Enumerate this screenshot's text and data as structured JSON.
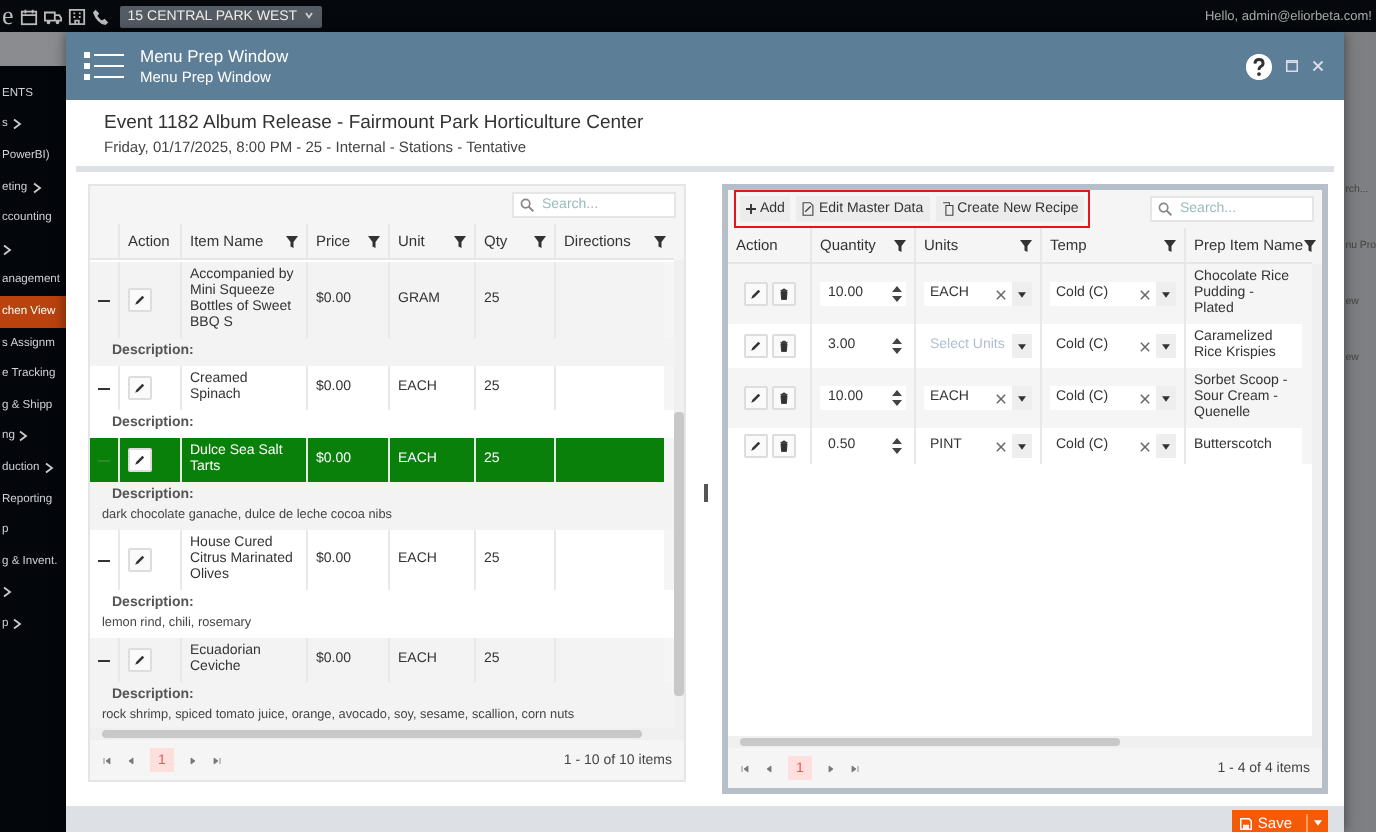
{
  "app": {
    "logo_fragment": "e",
    "location": "15 CENTRAL PARK WEST",
    "greeting": "Hello, admin@eliorbeta.com!",
    "sidebar": [
      {
        "label": "ENTS",
        "arrow": false,
        "selected": false
      },
      {
        "label": "s",
        "arrow": true,
        "selected": false
      },
      {
        "label": "PowerBI)",
        "arrow": false,
        "selected": false
      },
      {
        "label": "eting",
        "arrow": true,
        "selected": false
      },
      {
        "label": "ccounting",
        "arrow": false,
        "selected": false
      },
      {
        "arrow": true,
        "selected": false
      },
      {
        "label": "anagement",
        "arrow": false,
        "selected": false
      },
      {
        "label": "chen View",
        "arrow": false,
        "selected": true
      },
      {
        "label": "s Assignm",
        "arrow": false,
        "selected": false
      },
      {
        "label": "e Tracking",
        "arrow": false,
        "selected": false
      },
      {
        "label": "g & Shipp",
        "arrow": false,
        "selected": false
      },
      {
        "label": "ng",
        "arrow": true,
        "selected": false
      },
      {
        "label": "duction",
        "arrow": true,
        "selected": false
      },
      {
        "label": "Reporting",
        "arrow": false,
        "selected": false
      },
      {
        "label": "p",
        "arrow": false,
        "selected": false
      },
      {
        "label": "g & Invent.",
        "arrow": false,
        "selected": false
      },
      {
        "arrow": true,
        "selected": false
      },
      {
        "label": "p",
        "arrow": true,
        "selected": false
      }
    ],
    "background_texts": [
      "rch...",
      "nu Pro",
      "ew",
      "ew"
    ]
  },
  "modal": {
    "title": "Menu Prep Window",
    "subtitle": "Menu Prep Window"
  },
  "event": {
    "title": "Event 1182 Album Release - Fairmount Park Horticulture Center",
    "details": "Friday, 01/17/2025, 8:00 PM - 25 - Internal - Stations - Tentative"
  },
  "items_grid": {
    "search": {
      "placeholder": "Search..."
    },
    "columns": [
      {
        "label": "Action",
        "filter": false
      },
      {
        "label": "Item Name",
        "filter": true
      },
      {
        "label": "Price",
        "filter": true
      },
      {
        "label": "Unit",
        "filter": true
      },
      {
        "label": "Qty",
        "filter": true
      },
      {
        "label": "Directions",
        "filter": true
      }
    ],
    "rows": [
      {
        "name": "Accompanied by Mini Squeeze Bottles of Sweet BBQ S",
        "price": "$0.00",
        "unit": "GRAM",
        "qty": "25",
        "expanded": true,
        "selected": false,
        "description_label": "Description:"
      },
      {
        "name": "Creamed Spinach",
        "price": "$0.00",
        "unit": "EACH",
        "qty": "25",
        "expanded": true,
        "selected": false,
        "description_label": "Description:"
      },
      {
        "name": "Dulce Sea Salt Tarts",
        "price": "$0.00",
        "unit": "EACH",
        "qty": "25",
        "expanded": true,
        "selected": true,
        "description_label": "Description:",
        "description": "dark chocolate ganache, dulce de leche cocoa nibs"
      },
      {
        "name": "House Cured Citrus Marinated Olives",
        "price": "$0.00",
        "unit": "EACH",
        "qty": "25",
        "expanded": true,
        "selected": false,
        "description_label": "Description:",
        "description": "lemon rind, chili, rosemary"
      },
      {
        "name": "Ecuadorian Ceviche",
        "price": "$0.00",
        "unit": "EACH",
        "qty": "25",
        "expanded": true,
        "selected": false,
        "description_label": "Description:",
        "description": "rock shrimp, spiced tomato juice, orange, avocado, soy, sesame, scallion, corn nuts"
      }
    ],
    "pages": [
      {
        "label": "1",
        "selected": true
      }
    ],
    "summary": "1 - 10 of 10 items"
  },
  "prep_grid": {
    "toolbar": {
      "highlighted": true,
      "buttons": [
        {
          "kind": "add",
          "label": "Add"
        },
        {
          "kind": "edit",
          "label": "Edit Master Data"
        },
        {
          "kind": "copy",
          "label": "Create New Recipe"
        }
      ]
    },
    "search": {
      "placeholder": "Search..."
    },
    "columns": [
      {
        "label": "Action",
        "filter": false
      },
      {
        "label": "Quantity",
        "filter": true
      },
      {
        "label": "Units",
        "filter": true
      },
      {
        "label": "Temp",
        "filter": true
      },
      {
        "label": "Prep Item Name",
        "filter": true
      }
    ],
    "rows": [
      {
        "quantity": "10.00",
        "units": {
          "value": "EACH"
        },
        "temp": {
          "value": "Cold (C)"
        },
        "name": "Chocolate Rice Pudding - Plated"
      },
      {
        "quantity": "3.00",
        "units": {
          "placeholder": "Select Units"
        },
        "temp": {
          "value": "Cold (C)"
        },
        "name": "Caramelized Rice Krispies"
      },
      {
        "quantity": "10.00",
        "units": {
          "value": "EACH"
        },
        "temp": {
          "value": "Cold (C)"
        },
        "name": "Sorbet Scoop - Sour Cream - Quenelle"
      },
      {
        "quantity": "0.50",
        "units": {
          "value": "PINT"
        },
        "temp": {
          "value": "Cold (C)"
        },
        "name": "Butterscotch"
      }
    ],
    "pages": [
      {
        "label": "1",
        "selected": true
      }
    ],
    "summary": "1 - 4 of 4 items"
  },
  "footer": {
    "save": "Save"
  }
}
